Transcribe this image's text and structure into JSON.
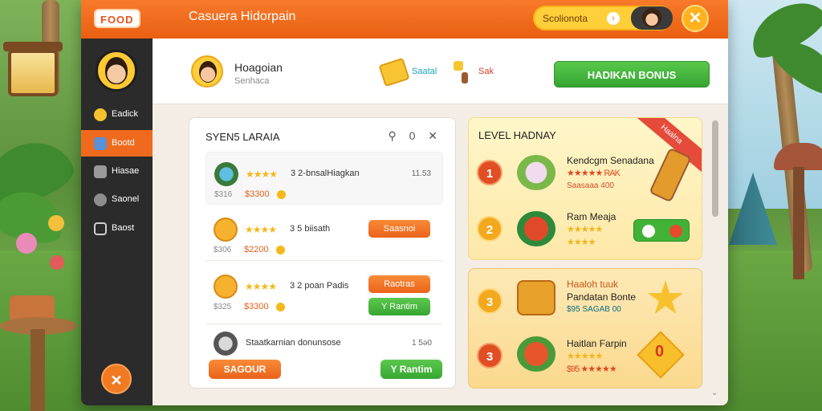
{
  "topbar": {
    "logo": "FOOD",
    "title": "Casuera Hidorpain",
    "user_name": "Scolionota",
    "arrow": "›",
    "close": "✕"
  },
  "sidebar": {
    "items": [
      {
        "label": "Eadick",
        "icon": "coin-icon",
        "active": false
      },
      {
        "label": "Bootd",
        "icon": "paint-icon",
        "active": true
      },
      {
        "label": "Hiasae",
        "icon": "wrench-icon",
        "active": false
      },
      {
        "label": "Saonel",
        "icon": "gear-icon",
        "active": false
      },
      {
        "label": "Baost",
        "icon": "book-icon",
        "active": false
      }
    ],
    "fab": "✕"
  },
  "header": {
    "name": "Hoagoian",
    "subtitle": "Senhaca",
    "ticket_label": "Saatal",
    "tool_label": "Sak",
    "bonus_button": "HADIKAN BONUS"
  },
  "left_panel": {
    "title": "SYEN5 LARAIA",
    "icons": "⚲ 0 ✕",
    "rows": [
      {
        "stars": "★★★★",
        "name": "3 2-bnsalHiagkan",
        "price": "$316",
        "price2": "$3300",
        "meta": "11.53",
        "button": ""
      },
      {
        "stars": "★★★★",
        "name": "3 5 biisath",
        "price": "$306",
        "price2": "$2200",
        "meta": "",
        "button": "Saasnoi"
      },
      {
        "stars": "★★★★",
        "name": "3 2 poan Padis",
        "price": "$325",
        "price2": "$3300",
        "meta": "",
        "button": "Raotras",
        "button2": "Y Rantim"
      },
      {
        "stars": "",
        "name": "Staatkarnian donunsose",
        "price": "",
        "price2": "",
        "meta": "1 5ə0",
        "button": ""
      }
    ],
    "bottom_left": "SAGOUR",
    "bottom_right": "Y Rantim"
  },
  "level_panel": {
    "title": "LEVEL HADNAY",
    "ribbon": "Haalna",
    "items": [
      {
        "level": "1",
        "title": "Kendcgm Senadana",
        "stars": "★★★★★ RAK",
        "sub": "Saasaaa 400"
      },
      {
        "level": "2",
        "title": "Ram Meaja",
        "stars": "★★★★★",
        "sub": "★★★★"
      }
    ]
  },
  "level_panel_2": {
    "items": [
      {
        "level": "3",
        "title": "Haaloh tuuk",
        "subtitle": "Pandatan Bonte",
        "stars": "$95 SAGAB 00"
      },
      {
        "level": "3",
        "title": "Haitlan Farpin",
        "stars": "★★★★★",
        "sub": "$95 ★★★★★"
      }
    ],
    "badge_number": "0"
  }
}
